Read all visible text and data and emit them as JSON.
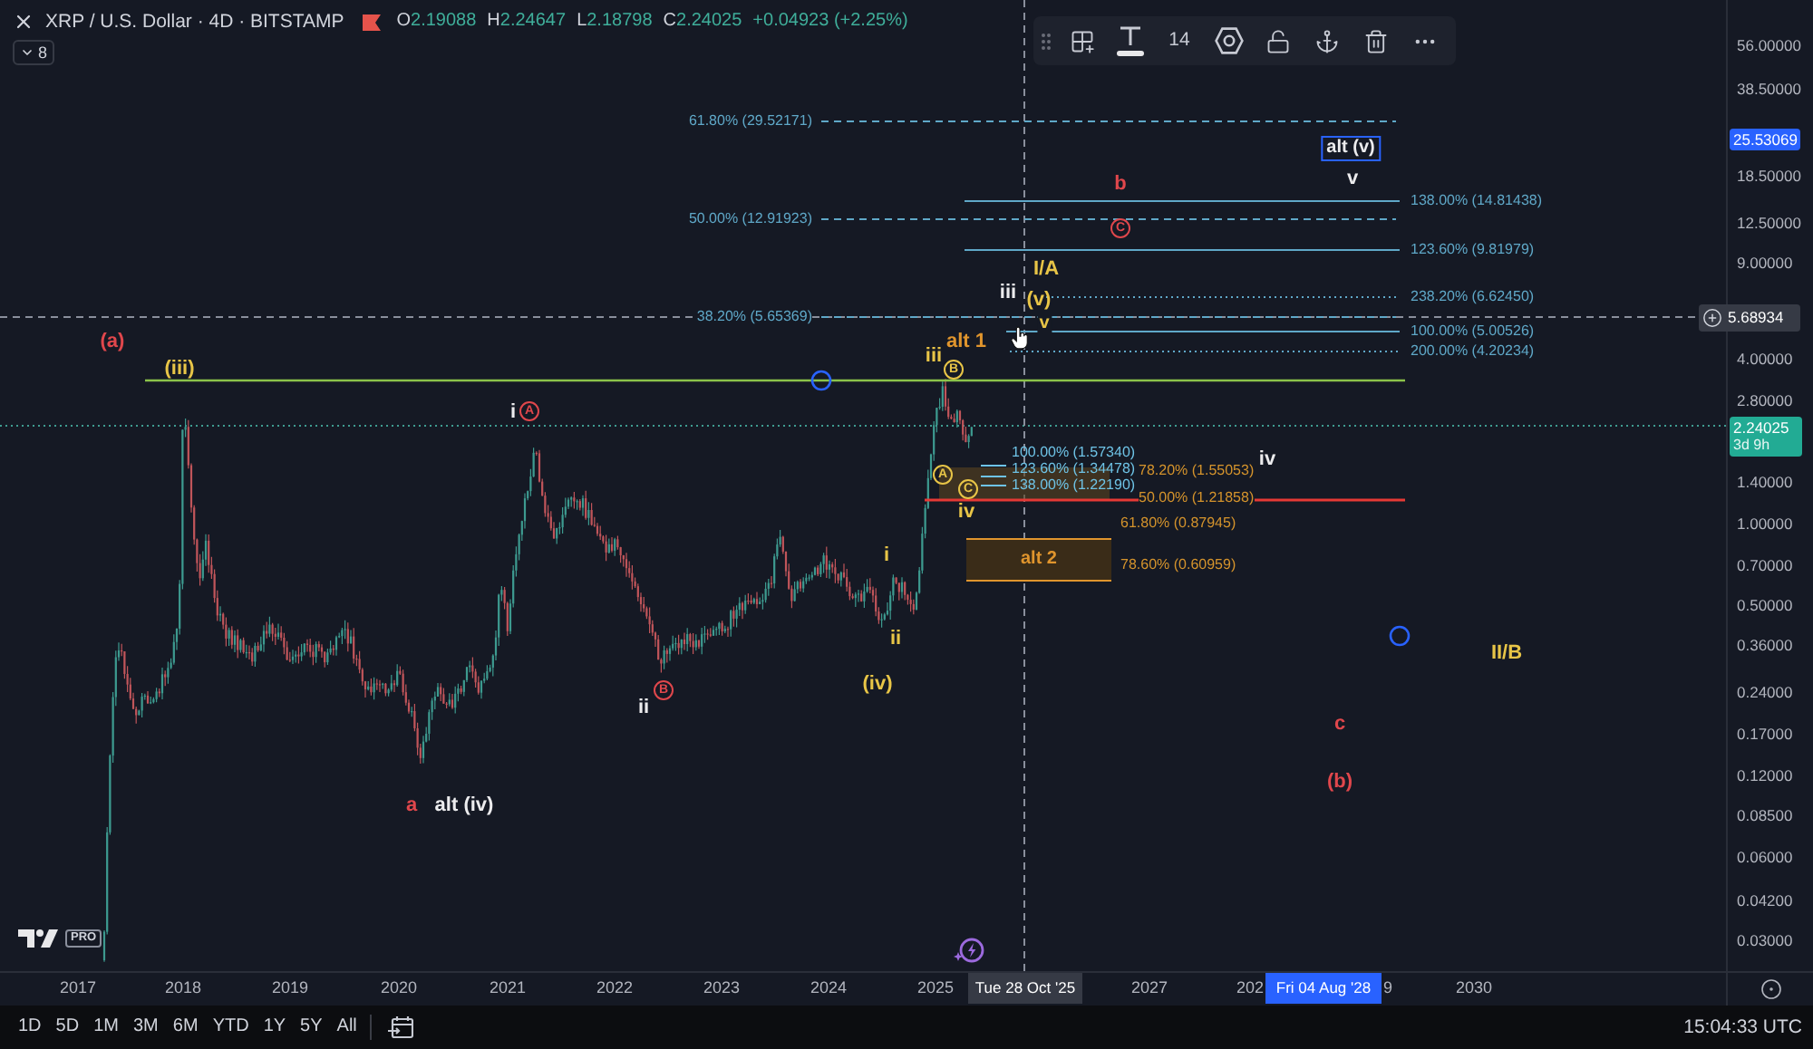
{
  "header": {
    "symbol": "XRP / U.S. Dollar · 4D · BITSTAMP",
    "ohlc": [
      {
        "label": "O",
        "value": "2.19088"
      },
      {
        "label": "H",
        "value": "2.24647"
      },
      {
        "label": "L",
        "value": "2.18798"
      },
      {
        "label": "C",
        "value": "2.24025"
      }
    ],
    "change": "+0.04923 (+2.25%)",
    "indicators_count": "8"
  },
  "drawing_toolbar": {
    "font_size": "14"
  },
  "fib_levels": [
    {
      "text": "61.80% (29.52171)",
      "color": "#5fa8c8",
      "kind": "dashed"
    },
    {
      "text": "50.00% (12.91923)",
      "color": "#5fa8c8",
      "kind": "dashed"
    },
    {
      "text": "38.20% (5.65369)",
      "color": "#5fa8c8",
      "kind": "dashed"
    },
    {
      "text": "138.00% (14.81438)",
      "color": "#5fa8c8",
      "kind": "solid"
    },
    {
      "text": "123.60% (9.81979)",
      "color": "#5fa8c8",
      "kind": "solid"
    },
    {
      "text": "238.20% (6.62450)",
      "color": "#5fa8c8",
      "kind": "dotted"
    },
    {
      "text": "100.00% (5.00526)",
      "color": "#5fa8c8",
      "kind": "solid"
    },
    {
      "text": "200.00% (4.20234)",
      "color": "#5fa8c8",
      "kind": "dotted"
    },
    {
      "text": "100.00% (1.57340)",
      "color": "#6ec3e6",
      "kind": "solid"
    },
    {
      "text": "123.60% (1.34478)",
      "color": "#6ec3e6",
      "kind": "solid"
    },
    {
      "text": "138.00% (1.22190)",
      "color": "#6ec3e6",
      "kind": "solid"
    },
    {
      "text": "78.20% (1.55053)",
      "color": "#d4932c",
      "kind": "label"
    },
    {
      "text": "50.00% (1.21858)",
      "color": "#d4932c",
      "kind": "label"
    },
    {
      "text": "61.80% (0.87945)",
      "color": "#d4932c",
      "kind": "label"
    },
    {
      "text": "78.60% (0.60959)",
      "color": "#d4932c",
      "kind": "label"
    }
  ],
  "wave_labels": [
    {
      "text": "alt (v)",
      "color": "#ececee",
      "kind": "boxed"
    },
    {
      "text": "b",
      "color": "#e0474c",
      "kind": "plain"
    },
    {
      "text": "v",
      "color": "#ececee",
      "kind": "plain"
    },
    {
      "text": "C",
      "color": "#e0474c",
      "kind": "circled"
    },
    {
      "text": "I/A",
      "color": "#e8c547",
      "kind": "plain"
    },
    {
      "text": "iii",
      "color": "#ececee",
      "kind": "plain"
    },
    {
      "text": "(v)",
      "color": "#e8c547",
      "kind": "plain"
    },
    {
      "text": "v",
      "color": "#e8c547",
      "kind": "plain"
    },
    {
      "text": "(a)",
      "color": "#e0474c",
      "kind": "plain"
    },
    {
      "text": "alt 1",
      "color": "#e0952d",
      "kind": "plain"
    },
    {
      "text": "iii",
      "color": "#e8c547",
      "kind": "plain"
    },
    {
      "text": "(iii)",
      "color": "#e8c547",
      "kind": "plain"
    },
    {
      "text": "B",
      "color": "#e8c547",
      "kind": "circled"
    },
    {
      "text": "i",
      "color": "#ececee",
      "kind": "plain"
    },
    {
      "text": "A",
      "color": "#e0474c",
      "kind": "circled"
    },
    {
      "text": "iv",
      "color": "#ececee",
      "kind": "plain"
    },
    {
      "text": "A",
      "color": "#e8c547",
      "kind": "circled"
    },
    {
      "text": "C",
      "color": "#e8c547",
      "kind": "circled"
    },
    {
      "text": "iv",
      "color": "#e8c547",
      "kind": "plain"
    },
    {
      "text": "i",
      "color": "#e8c547",
      "kind": "plain"
    },
    {
      "text": "alt 2",
      "color": "#e0952d",
      "kind": "zone"
    },
    {
      "text": "ii",
      "color": "#e8c547",
      "kind": "plain"
    },
    {
      "text": "II/B",
      "color": "#e8c547",
      "kind": "plain"
    },
    {
      "text": "B",
      "color": "#e0474c",
      "kind": "circled"
    },
    {
      "text": "(iv)",
      "color": "#e8c547",
      "kind": "plain"
    },
    {
      "text": "ii",
      "color": "#ececee",
      "kind": "plain"
    },
    {
      "text": "c",
      "color": "#e0474c",
      "kind": "plain"
    },
    {
      "text": "(b)",
      "color": "#e0474c",
      "kind": "plain"
    },
    {
      "text": "a",
      "color": "#e0474c",
      "kind": "plain"
    },
    {
      "text": "alt (iv)",
      "color": "#ececee",
      "kind": "plain"
    }
  ],
  "price_axis": {
    "ticks": [
      "56.00000",
      "38.50000",
      "18.50000",
      "12.50000",
      "9.00000",
      "4.00000",
      "2.80000",
      "1.40000",
      "1.00000",
      "0.70000",
      "0.50000",
      "0.36000",
      "0.24000",
      "0.17000",
      "0.12000",
      "0.08500",
      "0.06000",
      "0.04200",
      "0.03000"
    ],
    "markers": [
      {
        "kind": "highlight",
        "text": "25.53069"
      },
      {
        "kind": "crosshair",
        "text": "5.68934"
      },
      {
        "kind": "last_price",
        "text": "2.24025",
        "countdown": "3d 9h"
      }
    ]
  },
  "time_axis": {
    "ticks": [
      "2017",
      "2018",
      "2019",
      "2020",
      "2021",
      "2022",
      "2023",
      "2024",
      "2025",
      "2027",
      "202",
      "9",
      "2030"
    ],
    "crosshair_label": "Tue 28 Oct '25",
    "highlight_label": "Fri 04 Aug '28"
  },
  "logo": {
    "badge": "PRO"
  },
  "range_buttons": [
    "1D",
    "5D",
    "1M",
    "3M",
    "6M",
    "YTD",
    "1Y",
    "5Y",
    "All"
  ],
  "clock": "15:04:33 UTC"
}
